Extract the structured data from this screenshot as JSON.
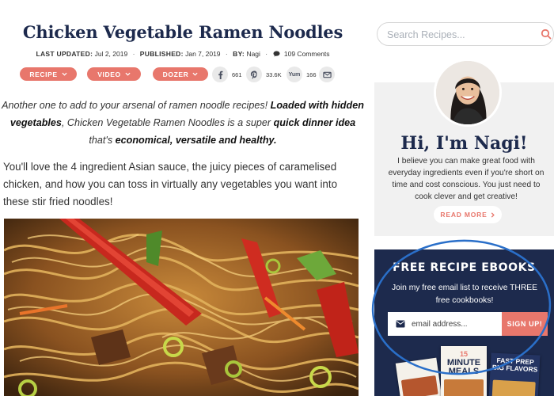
{
  "post": {
    "title": "Chicken Vegetable Ramen Noodles",
    "meta": {
      "updated_label": "LAST UPDATED:",
      "updated_date": "Jul 2, 2019",
      "published_label": "PUBLISHED:",
      "published_date": "Jan 7, 2019",
      "by_label": "BY:",
      "author": "Nagi",
      "comments": "109 Comments"
    },
    "actions": {
      "recipe_label": "RECIPE",
      "video_label": "VIDEO",
      "dozer_label": "DOZER"
    },
    "share": {
      "facebook_count": "661",
      "pinterest_count": "33.6K",
      "yummly_label": "Yum",
      "yummly_count": "166"
    },
    "intro": {
      "part1": "Another one to add to your arsenal of ramen noodle recipes! ",
      "part2": "Loaded with hidden vegetables",
      "part3": ", Chicken Vegetable Ramen Noodles is a super ",
      "part4": "quick dinner idea",
      "part5": " that's ",
      "part6": "economical, versatile and healthy."
    },
    "body_text": "You'll love the 4 ingredient Asian sauce, the juicy pieces of caramelised chicken, and how you can toss in virtually any vegetables you want into these stir fried noodles!"
  },
  "sidebar": {
    "search_placeholder": "Search Recipes...",
    "about": {
      "heading": "Hi, I'm Nagi!",
      "text": "I believe you can make great food with everyday ingredients even if you're short on time and cost conscious. You just need to cook clever and get creative!",
      "read_more_label": "READ MORE"
    },
    "ebooks": {
      "heading": "FREE RECIPE EBOOKS",
      "text": "Join my free email list to receive THREE free cookbooks!",
      "email_placeholder": "email address...",
      "signup_label": "SIGN UP!",
      "book2_number": "15",
      "book2_title": "MINUTE MEALS",
      "book3_title": "FAST PREP BIG FLAVORS"
    }
  },
  "colors": {
    "navy": "#1d2a4d",
    "coral": "#e8776c",
    "annotation": "#2a6fc9"
  }
}
